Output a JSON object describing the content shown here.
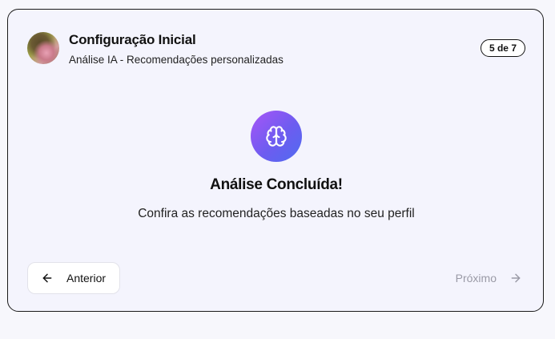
{
  "header": {
    "title": "Configuração Inicial",
    "subtitle": "Análise IA - Recomendações personalizadas",
    "step_badge": "5 de 7",
    "avatar_icon": "user-avatar-photo"
  },
  "main": {
    "icon": "brain-icon",
    "icon_gradient": [
      "#a855f7",
      "#4f6cf0"
    ],
    "heading": "Análise Concluída!",
    "description": "Confira as recomendações baseadas no seu perfil"
  },
  "footer": {
    "prev_label": "Anterior",
    "prev_icon": "arrow-left-icon",
    "next_label": "Próximo",
    "next_icon": "arrow-right-icon",
    "next_disabled": true
  }
}
